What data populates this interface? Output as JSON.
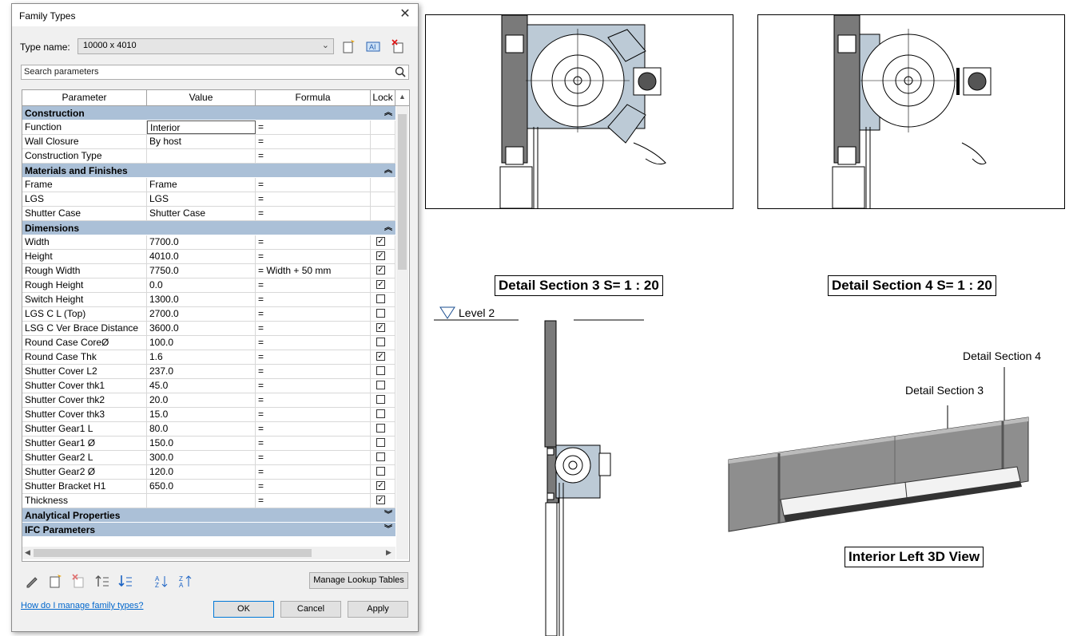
{
  "dialog": {
    "title": "Family Types",
    "type_name_label": "Type name:",
    "type_name_value": "10000 x 4010",
    "search_placeholder": "Search parameters",
    "columns": [
      "Parameter",
      "Value",
      "Formula",
      "Lock"
    ],
    "groups": [
      {
        "name": "Construction",
        "rows": [
          {
            "param": "Function",
            "value": "Interior",
            "formula": "=",
            "lock": null,
            "editing": true
          },
          {
            "param": "Wall Closure",
            "value": "By host",
            "formula": "=",
            "lock": null
          },
          {
            "param": "Construction Type",
            "value": "",
            "formula": "=",
            "lock": null
          }
        ]
      },
      {
        "name": "Materials and Finishes",
        "rows": [
          {
            "param": "Frame",
            "value": "Frame",
            "formula": "=",
            "lock": null
          },
          {
            "param": "LGS",
            "value": "LGS",
            "formula": "=",
            "lock": null
          },
          {
            "param": "Shutter Case",
            "value": "Shutter Case",
            "formula": "=",
            "lock": null
          }
        ]
      },
      {
        "name": "Dimensions",
        "rows": [
          {
            "param": "Width",
            "value": "7700.0",
            "formula": "=",
            "lock": true
          },
          {
            "param": "Height",
            "value": "4010.0",
            "formula": "=",
            "lock": true
          },
          {
            "param": "Rough Width",
            "value": "7750.0",
            "formula": "= Width + 50 mm",
            "lock": true
          },
          {
            "param": "Rough Height",
            "value": "0.0",
            "formula": "=",
            "lock": true
          },
          {
            "param": "Switch Height",
            "value": "1300.0",
            "formula": "=",
            "lock": false
          },
          {
            "param": "LGS C L (Top)",
            "value": "2700.0",
            "formula": "=",
            "lock": false
          },
          {
            "param": "LSG C Ver Brace Distance",
            "value": "3600.0",
            "formula": "=",
            "lock": true
          },
          {
            "param": "Round Case CoreØ",
            "value": "100.0",
            "formula": "=",
            "lock": false
          },
          {
            "param": "Round Case Thk",
            "value": "1.6",
            "formula": "=",
            "lock": true
          },
          {
            "param": "Shutter Cover L2",
            "value": "237.0",
            "formula": "=",
            "lock": false
          },
          {
            "param": "Shutter Cover thk1",
            "value": "45.0",
            "formula": "=",
            "lock": false
          },
          {
            "param": "Shutter Cover thk2",
            "value": "20.0",
            "formula": "=",
            "lock": false
          },
          {
            "param": "Shutter Cover thk3",
            "value": "15.0",
            "formula": "=",
            "lock": false
          },
          {
            "param": "Shutter Gear1 L",
            "value": "80.0",
            "formula": "=",
            "lock": false
          },
          {
            "param": "Shutter Gear1 Ø",
            "value": "150.0",
            "formula": "=",
            "lock": false
          },
          {
            "param": "Shutter Gear2 L",
            "value": "300.0",
            "formula": "=",
            "lock": false
          },
          {
            "param": "Shutter Gear2 Ø",
            "value": "120.0",
            "formula": "=",
            "lock": false
          },
          {
            "param": "Shutter Bracket H1",
            "value": "650.0",
            "formula": "=",
            "lock": true
          },
          {
            "param": "Thickness",
            "value": "",
            "formula": "=",
            "lock": true
          }
        ]
      },
      {
        "name": "Analytical Properties",
        "collapsed": true,
        "rows": []
      },
      {
        "name": "IFC Parameters",
        "collapsed": true,
        "rows": []
      }
    ],
    "manage_lookup": "Manage Lookup Tables",
    "help_link": "How do I manage family types?",
    "ok": "OK",
    "cancel": "Cancel",
    "apply": "Apply"
  },
  "drawing": {
    "caption_section3": "Detail Section 3  S= 1 : 20",
    "caption_section4": "Detail Section 4  S= 1 : 20",
    "level_label": "Level 2",
    "callout_section4": "Detail Section 4",
    "callout_section3": "Detail Section 3",
    "caption_3d": "Interior Left 3D View"
  }
}
